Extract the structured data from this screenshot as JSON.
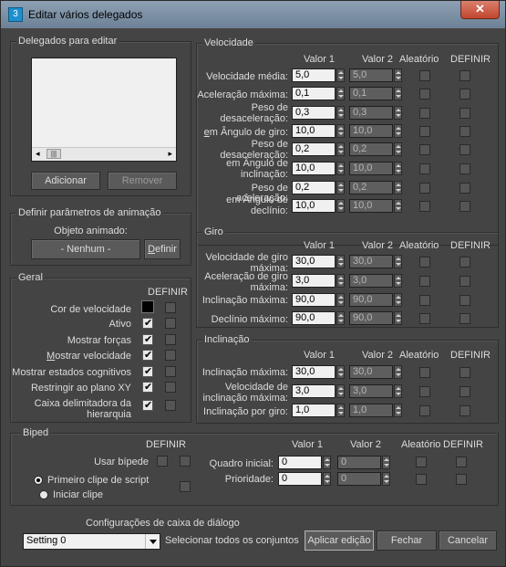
{
  "window": {
    "title": "Editar vários delegados",
    "close": "✕"
  },
  "delegates": {
    "legend": "Delegados para editar",
    "add": "Adicionar",
    "remove": "Remover"
  },
  "anim": {
    "legend": "Definir parâmetros de animação",
    "object_label": "Objeto animado:",
    "object_value": "- Nenhum -",
    "define": "Definir"
  },
  "geral": {
    "legend": "Geral",
    "definir": "DEFINIR",
    "rows": [
      {
        "label": "Cor de velocidade",
        "value": "color"
      },
      {
        "label": "Ativo",
        "value": true
      },
      {
        "label": "Mostrar forças",
        "value": true
      },
      {
        "label": "Mostrar velocidade",
        "value": true
      },
      {
        "label": "Mostrar estados cognitivos",
        "value": true
      },
      {
        "label": "Restringir ao plano XY",
        "value": true
      },
      {
        "label": "Caixa delimitadora da hierarquia",
        "value": true
      }
    ]
  },
  "headers": {
    "v1": "Valor 1",
    "v2": "Valor 2",
    "random": "Aleatório",
    "definir": "DEFINIR"
  },
  "velocidade": {
    "legend": "Velocidade",
    "rows": [
      {
        "label": "Velocidade média:",
        "v1": "5,0",
        "v2": "5,0"
      },
      {
        "label": "Aceleração máxima:",
        "v1": "0,1",
        "v2": "0,1"
      },
      {
        "label": "Peso de desaceleração:",
        "v1": "0,3",
        "v2": "0,3"
      },
      {
        "label": "em Ângulo de giro:",
        "v1": "10,0",
        "v2": "10,0"
      },
      {
        "label": "Peso de desaceleração:",
        "v1": "0,2",
        "v2": "0,2"
      },
      {
        "label": "em Ângulo de inclinação:",
        "v1": "10,0",
        "v2": "10,0"
      },
      {
        "label": "Peso de aceleração:",
        "v1": "0,2",
        "v2": "0,2"
      },
      {
        "label": "em Ângulo de declínio:",
        "v1": "10,0",
        "v2": "10,0"
      }
    ]
  },
  "giro": {
    "legend": "Giro",
    "rows": [
      {
        "label": "Velocidade de giro máxima:",
        "v1": "30,0",
        "v2": "30,0"
      },
      {
        "label": "Aceleração de giro máxima:",
        "v1": "3,0",
        "v2": "3,0"
      },
      {
        "label": "Inclinação máxima:",
        "v1": "90,0",
        "v2": "90,0"
      },
      {
        "label": "Declínio máximo:",
        "v1": "90,0",
        "v2": "90,0"
      }
    ]
  },
  "inclinacao": {
    "legend": "Inclinação",
    "rows": [
      {
        "label": "Inclinação máxima:",
        "v1": "30,0",
        "v2": "30,0"
      },
      {
        "label": "Velocidade de inclinação máxima:",
        "v1": "3,0",
        "v2": "3,0"
      },
      {
        "label": "Inclinação por giro:",
        "v1": "1,0",
        "v2": "1,0"
      }
    ]
  },
  "biped": {
    "legend": "Biped",
    "definir": "DEFINIR",
    "use_biped": "Usar bípede",
    "first_clip": "Primeiro clipe de script",
    "start_clip": "Iniciar clipe",
    "v1": "Valor 1",
    "v2": "Valor 2",
    "random": "Aleatório",
    "definir2": "DEFINIR",
    "initial_frame": "Quadro inicial:",
    "priority": "Prioridade:",
    "initial_v1": "0",
    "initial_v2": "0",
    "priority_v1": "0",
    "priority_v2": "0"
  },
  "footer": {
    "settings_label": "Configurações de caixa de diálogo",
    "setting_value": "Setting 0",
    "select_all": "Selecionar todos os conjuntos",
    "apply": "Aplicar edição",
    "close": "Fechar",
    "cancel": "Cancelar"
  }
}
